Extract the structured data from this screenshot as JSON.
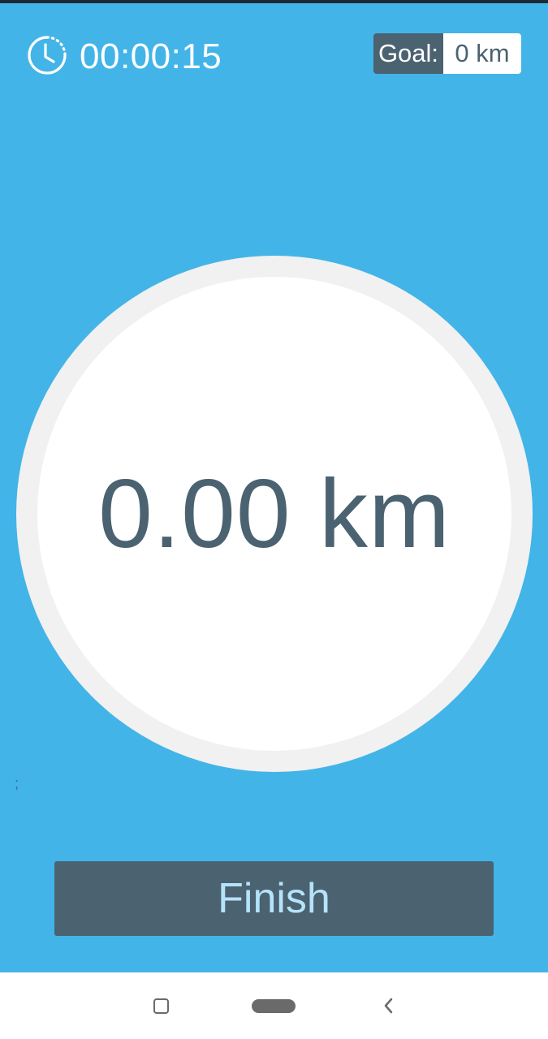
{
  "timer": {
    "value": "00:00:15",
    "icon": "clock-icon"
  },
  "goal": {
    "label": "Goal:",
    "value": "0 km"
  },
  "distance": {
    "value": "0.00 km"
  },
  "stray_text": ";",
  "finish_button": {
    "label": "Finish"
  },
  "navbar": {
    "recents_icon": "square-icon",
    "home_icon": "pill-icon",
    "back_icon": "chevron-left-icon"
  },
  "colors": {
    "background": "#43b4e8",
    "accent_dark": "#4b6271",
    "finish_text": "#b5e3fa",
    "ring": "#f1f1f1"
  }
}
